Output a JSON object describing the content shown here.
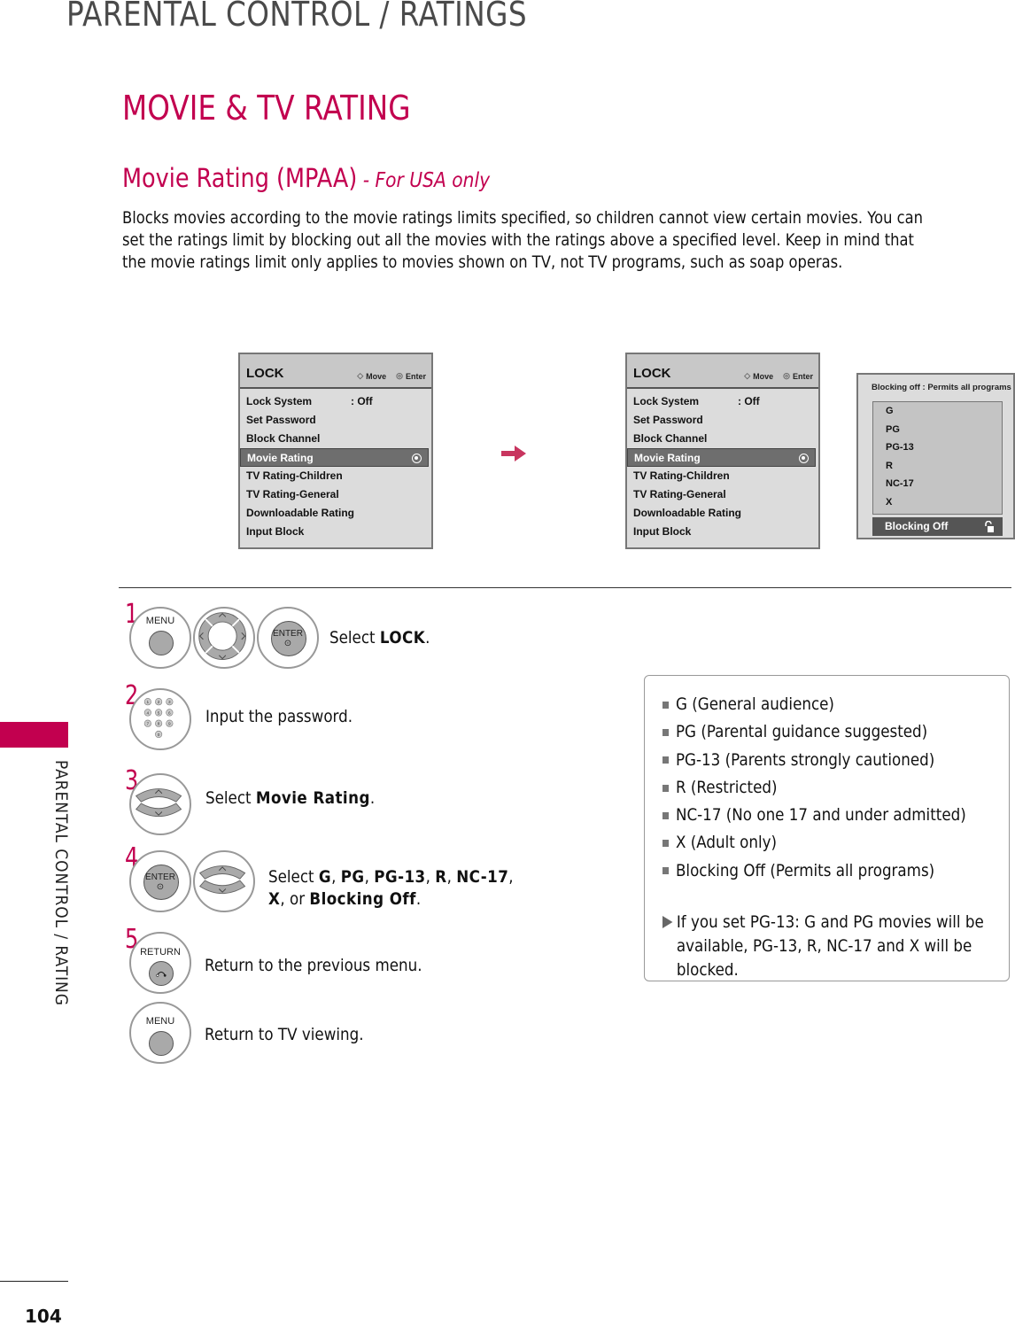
{
  "page_header": "PARENTAL CONTROL / RATINGS",
  "side_label": "PARENTAL CONTROL / RATING",
  "accent_color": "#c2004f",
  "heading": "MOVIE & TV RATING",
  "subheading": {
    "main": "Movie Rating (MPAA)",
    "suffix": " - For USA only"
  },
  "intro_lines": [
    "Blocks movies according to the movie ratings limits specified, so children cannot view certain movies. You can",
    "set the ratings limit by blocking out all the movies with the ratings above a specified level. Keep in mind that",
    "the movie ratings limit only applies to movies shown on TV, not TV programs, such as soap operas."
  ],
  "osd_menu": {
    "title": "LOCK",
    "hint_move": "Move",
    "hint_enter": "Enter",
    "hint_move_icon": "dpad-icon",
    "hint_enter_icon": "enter-icon",
    "items": [
      {
        "label": "Lock System",
        "value": ": Off"
      },
      {
        "label": "Set Password",
        "value": ""
      },
      {
        "label": "Block Channel",
        "value": ""
      },
      {
        "label": "Movie Rating",
        "value": "",
        "selected": true
      },
      {
        "label": "TV Rating-Children",
        "value": ""
      },
      {
        "label": "TV Rating-General",
        "value": ""
      },
      {
        "label": "Downloadable Rating",
        "value": ""
      },
      {
        "label": "Input Block",
        "value": ""
      }
    ]
  },
  "rating_submenu": {
    "title": "Blocking off : Permits all programs",
    "options": [
      "G",
      "PG",
      "PG-13",
      "R",
      "NC-17",
      "X"
    ],
    "selected": "Blocking Off",
    "selected_icon": "unlock-icon"
  },
  "steps": [
    {
      "number": "1",
      "buttons": [
        "MENU",
        "NAVIGATION",
        "ENTER"
      ],
      "text_prefix": "Select ",
      "text_bold": "LOCK",
      "text_suffix": "."
    },
    {
      "number": "2",
      "buttons": [
        "NUMBER"
      ],
      "keypad": [
        "1",
        "2",
        "3",
        "4",
        "5",
        "6",
        "7",
        "8",
        "9",
        "0"
      ],
      "text": "Input the password."
    },
    {
      "number": "3",
      "buttons": [
        "UP/DOWN"
      ],
      "text_prefix": "Select ",
      "text_bold": "Movie Rating",
      "text_suffix": "."
    },
    {
      "number": "4",
      "buttons": [
        "ENTER",
        "UP/DOWN"
      ],
      "text_prefix": "Select ",
      "line1_bold": [
        "G",
        "PG",
        "PG-13",
        "R",
        "NC-17"
      ],
      "line2_bold_a": "X",
      "line2_mid": ", or ",
      "line2_bold_b": "Blocking Off",
      "text_suffix": "."
    },
    {
      "number": "5",
      "buttons": [
        "RETURN"
      ],
      "text": "Return to the previous menu."
    },
    {
      "number": "",
      "buttons": [
        "MENU"
      ],
      "text": "Return to TV viewing."
    }
  ],
  "button_labels": {
    "menu": "MENU",
    "enter": "ENTER",
    "return": "RETURN"
  },
  "info_box": {
    "items": [
      "G (General audience)",
      "PG (Parental guidance suggested)",
      "PG-13  (Parents strongly cautioned)",
      "R (Restricted)",
      "NC-17 (No one 17 and under admitted)",
      "X (Adult only)",
      "Blocking Off (Permits all programs)"
    ],
    "note": "If you set PG-13: G and PG movies will be available, PG-13, R, NC-17 and X will be blocked."
  },
  "page_number": "104"
}
